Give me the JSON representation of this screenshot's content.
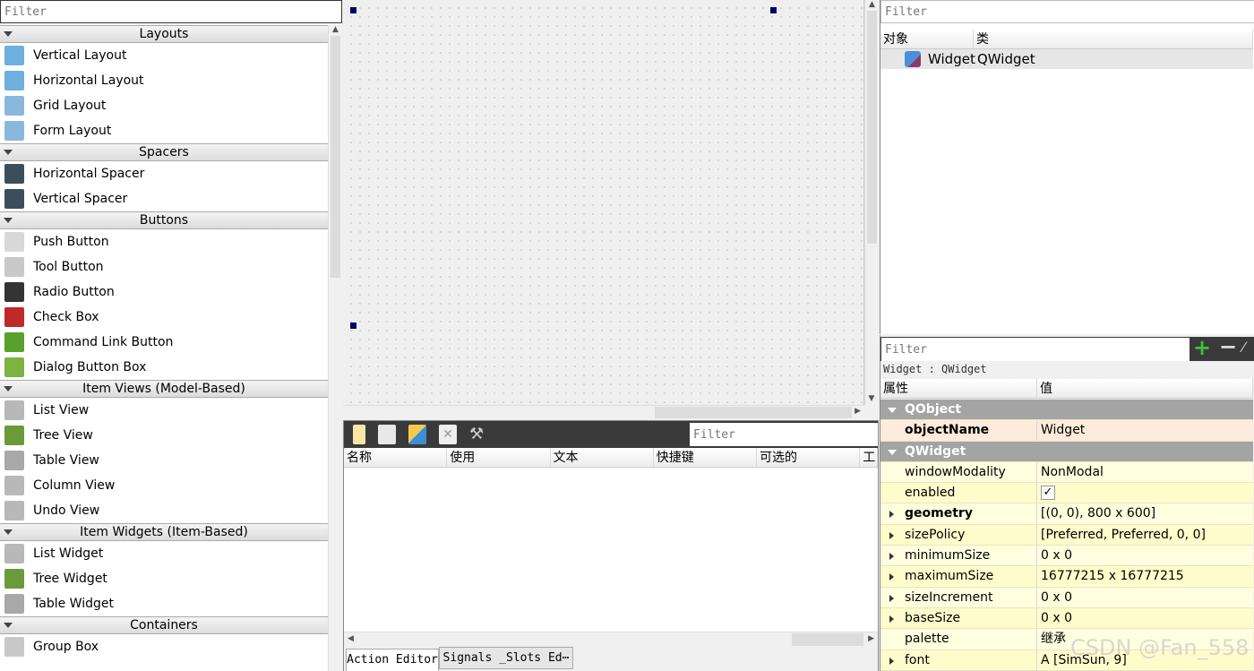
{
  "widget_box": {
    "filter_placeholder": "Filter",
    "categories": [
      {
        "label": "Layouts",
        "items": [
          {
            "label": "Vertical Layout",
            "icon": "vertical-layout-icon",
            "color": "#6fb0e0"
          },
          {
            "label": "Horizontal Layout",
            "icon": "horizontal-layout-icon",
            "color": "#6fb0e0"
          },
          {
            "label": "Grid Layout",
            "icon": "grid-layout-icon",
            "color": "#8ab8dd"
          },
          {
            "label": "Form Layout",
            "icon": "form-layout-icon",
            "color": "#8ab8dd"
          }
        ]
      },
      {
        "label": "Spacers",
        "items": [
          {
            "label": "Horizontal Spacer",
            "icon": "horizontal-spacer-icon",
            "color": "#3c4e5a"
          },
          {
            "label": "Vertical Spacer",
            "icon": "vertical-spacer-icon",
            "color": "#3c4e5a"
          }
        ]
      },
      {
        "label": "Buttons",
        "items": [
          {
            "label": "Push Button",
            "icon": "push-button-icon",
            "color": "#d8d8d8"
          },
          {
            "label": "Tool Button",
            "icon": "tool-button-icon",
            "color": "#c8c8c8"
          },
          {
            "label": "Radio Button",
            "icon": "radio-button-icon",
            "color": "#333333"
          },
          {
            "label": "Check Box",
            "icon": "check-box-icon",
            "color": "#c0282a"
          },
          {
            "label": "Command Link Button",
            "icon": "command-link-icon",
            "color": "#5aa02c"
          },
          {
            "label": "Dialog Button Box",
            "icon": "dialog-button-box-icon",
            "color": "#7cb342"
          }
        ]
      },
      {
        "label": "Item Views (Model-Based)",
        "items": [
          {
            "label": "List View",
            "icon": "list-view-icon",
            "color": "#b8b8b8"
          },
          {
            "label": "Tree View",
            "icon": "tree-view-icon",
            "color": "#6a9a3a"
          },
          {
            "label": "Table View",
            "icon": "table-view-icon",
            "color": "#a8a8a8"
          },
          {
            "label": "Column View",
            "icon": "column-view-icon",
            "color": "#b8b8b8"
          },
          {
            "label": "Undo View",
            "icon": "undo-view-icon",
            "color": "#b8b8b8"
          }
        ]
      },
      {
        "label": "Item Widgets (Item-Based)",
        "items": [
          {
            "label": "List Widget",
            "icon": "list-widget-icon",
            "color": "#b8b8b8"
          },
          {
            "label": "Tree Widget",
            "icon": "tree-widget-icon",
            "color": "#6a9a3a"
          },
          {
            "label": "Table Widget",
            "icon": "table-widget-icon",
            "color": "#a8a8a8"
          }
        ]
      },
      {
        "label": "Containers",
        "items": [
          {
            "label": "Group Box",
            "icon": "group-box-icon",
            "color": "#c8c8c8"
          }
        ]
      }
    ]
  },
  "action_editor": {
    "filter_placeholder": "Filter",
    "toolbar": [
      "new-action-icon",
      "copy-action-icon",
      "paste-action-icon",
      "delete-action-icon",
      "configure-icon"
    ],
    "columns": [
      "名称",
      "使用",
      "文本",
      "快捷键",
      "可选的",
      "工"
    ],
    "tabs": [
      "Action Editor",
      "Signals _Slots Ed⋯"
    ]
  },
  "object_inspector": {
    "filter_placeholder": "Filter",
    "columns": [
      "对象",
      "类"
    ],
    "rows": [
      {
        "object": "Widget",
        "class": "QWidget"
      }
    ]
  },
  "property_editor": {
    "filter_placeholder": "Filter",
    "context": "Widget : QWidget",
    "columns": [
      "属性",
      "值"
    ],
    "rows": [
      {
        "type": "group",
        "name": "QObject"
      },
      {
        "type": "prop",
        "name": "objectName",
        "value": "Widget",
        "bold": true,
        "bg": "#fdebdc"
      },
      {
        "type": "group",
        "name": "QWidget"
      },
      {
        "type": "prop",
        "name": "windowModality",
        "value": "NonModal",
        "bg": "#ffffe0"
      },
      {
        "type": "prop",
        "name": "enabled",
        "value": "✓",
        "checkbox": true,
        "bg": "#fffccc"
      },
      {
        "type": "prop",
        "name": "geometry",
        "value": "[(0, 0), 800 x 600]",
        "bold": true,
        "expandable": true,
        "bg": "#ffffe0"
      },
      {
        "type": "prop",
        "name": "sizePolicy",
        "value": "[Preferred, Preferred, 0, 0]",
        "expandable": true,
        "bg": "#fffccc"
      },
      {
        "type": "prop",
        "name": "minimumSize",
        "value": "0 x 0",
        "expandable": true,
        "bg": "#ffffe0"
      },
      {
        "type": "prop",
        "name": "maximumSize",
        "value": "16777215 x 16777215",
        "expandable": true,
        "bg": "#fffccc"
      },
      {
        "type": "prop",
        "name": "sizeIncrement",
        "value": "0 x 0",
        "expandable": true,
        "bg": "#ffffe0"
      },
      {
        "type": "prop",
        "name": "baseSize",
        "value": "0 x 0",
        "expandable": true,
        "bg": "#fffccc"
      },
      {
        "type": "prop",
        "name": "palette",
        "value": "继承",
        "bg": "#ffffe0"
      },
      {
        "type": "prop",
        "name": "font",
        "value": "A  [SimSun, 9]",
        "expandable": true,
        "bg": "#fffccc"
      }
    ]
  },
  "watermark": "CSDN @Fan_558"
}
